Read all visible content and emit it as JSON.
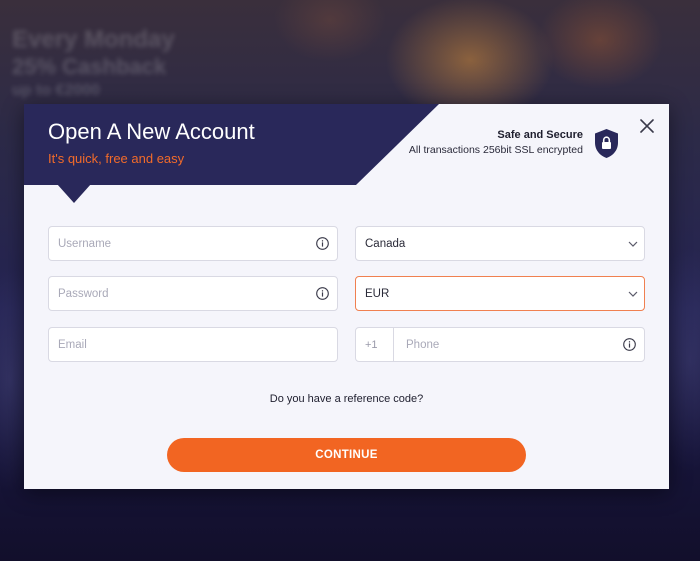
{
  "background": {
    "lines": [
      "Every Monday",
      "25% Cashback",
      "up to €2000"
    ]
  },
  "modal": {
    "title": "Open A New Account",
    "subtitle": "It's quick, free and easy",
    "secure_title": "Safe and Secure",
    "secure_subtitle": "All transactions 256bit SSL encrypted",
    "close_icon": "close-icon",
    "shield_icon": "shield-lock-icon"
  },
  "form": {
    "username": {
      "placeholder": "Username",
      "value": ""
    },
    "password": {
      "placeholder": "Password",
      "value": ""
    },
    "email": {
      "placeholder": "Email",
      "value": ""
    },
    "country": {
      "value": "Canada"
    },
    "currency": {
      "value": "EUR"
    },
    "phone": {
      "prefix": "+1",
      "placeholder": "Phone",
      "value": ""
    },
    "reference_question": "Do you have a reference code?",
    "continue_label": "CONTINUE"
  },
  "colors": {
    "accent": "#f26522",
    "banner": "#29285a",
    "subtitle": "#f26b2a",
    "active_border": "#f08050"
  }
}
